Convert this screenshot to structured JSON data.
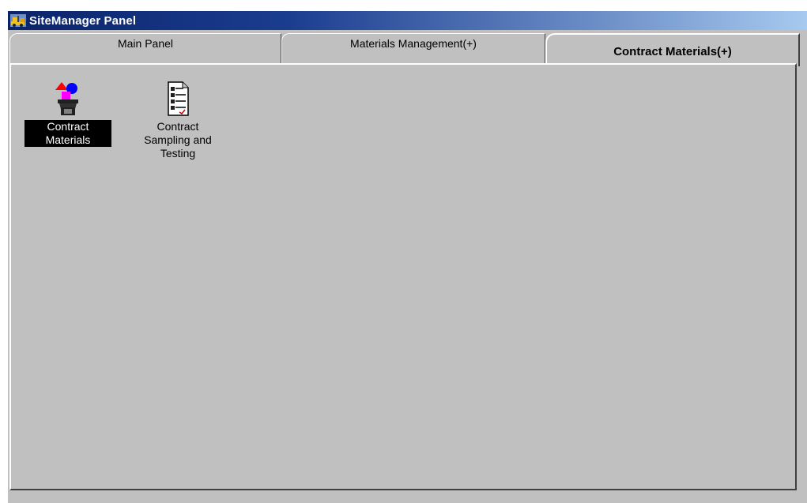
{
  "window": {
    "title": "SiteManager Panel"
  },
  "tabs": [
    {
      "label": "Main Panel",
      "active": false
    },
    {
      "label": "Materials Management(+)",
      "active": false
    },
    {
      "label": "Contract Materials(+)",
      "active": true
    }
  ],
  "panel": {
    "items": [
      {
        "label": "Contract Materials",
        "icon": "contract-materials-icon",
        "selected": true
      },
      {
        "label": "Contract Sampling and Testing",
        "icon": "document-list-icon",
        "selected": false
      }
    ]
  },
  "colors": {
    "face": "#c0c0c0",
    "title_start": "#0a246a",
    "title_end": "#a6caf0",
    "selection": "#000000"
  }
}
